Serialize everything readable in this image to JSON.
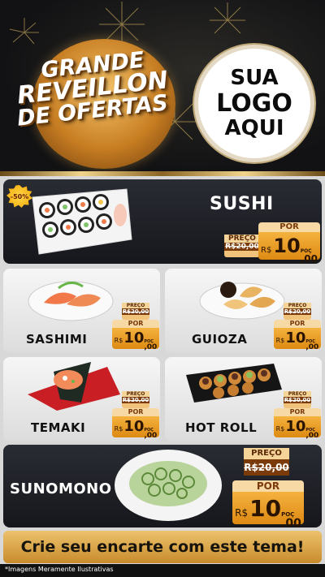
{
  "header": {
    "banner": {
      "line1": "GRANDE",
      "line2": "REVEILLON",
      "line3": "DE OFERTAS"
    },
    "logo": {
      "line1": "SUA",
      "line2": "LOGO",
      "line3": "AQUI"
    }
  },
  "badge": "-50%",
  "products": {
    "sushi": {
      "name": "SUSHI",
      "prev_label": "PREÇO",
      "prev_value": "R$20,00",
      "now_label": "POR",
      "currency": "R$",
      "int": "10",
      "dec": ",00",
      "unit": "POÇ"
    },
    "sashimi": {
      "name": "SASHIMI",
      "prev_label": "PREÇO",
      "prev_value": "R$20,00",
      "now_label": "POR",
      "currency": "R$",
      "int": "10",
      "dec": ",00",
      "unit": "POÇ"
    },
    "guioza": {
      "name": "GUIOZA",
      "prev_label": "PREÇO",
      "prev_value": "R$20,00",
      "now_label": "POR",
      "currency": "R$",
      "int": "10",
      "dec": ",00",
      "unit": "POÇ"
    },
    "temaki": {
      "name": "TEMAKI",
      "prev_label": "PREÇO",
      "prev_value": "R$20,00",
      "now_label": "POR",
      "currency": "R$",
      "int": "10",
      "dec": ",00",
      "unit": "POÇ"
    },
    "hotroll": {
      "name": "HOT ROLL",
      "prev_label": "PREÇO",
      "prev_value": "R$20,00",
      "now_label": "POR",
      "currency": "R$",
      "int": "10",
      "dec": ",00",
      "unit": "POÇ"
    },
    "sunomono": {
      "name": "SUNOMONO",
      "prev_label": "PREÇO",
      "prev_value": "R$20,00",
      "now_label": "POR",
      "currency": "R$",
      "int": "10",
      "dec": ",00",
      "unit": "POÇ"
    }
  },
  "footer": {
    "cta": "Crie seu encarte com este tema!",
    "disclaimer": "*Imagens Meramente Ilustrativas"
  },
  "colors": {
    "gold": "#f0b23c",
    "dark_card": "#1c1d23",
    "light_card": "#eeeeee",
    "price_brown": "#7a3a0a"
  }
}
